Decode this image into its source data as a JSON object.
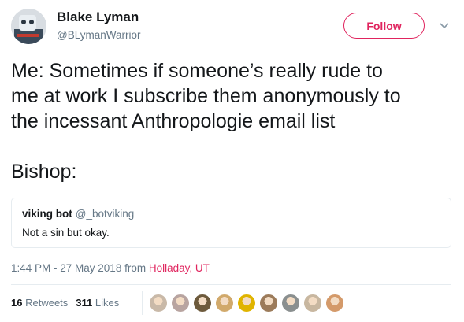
{
  "author": {
    "display_name": "Blake Lyman",
    "handle": "@BLymanWarrior"
  },
  "follow_button": {
    "label": "Follow",
    "accent": "#e0245e"
  },
  "menu_caret_icon": "chevron-down-icon",
  "tweet": {
    "lines": [
      "Me: Sometimes if someone’s really rude to",
      "me at work I subscribe them anonymously to",
      "the incessant Anthropologie email list",
      "Bishop:"
    ]
  },
  "quote": {
    "name": "viking bot",
    "handle": "@_botviking",
    "text": "Not a sin but okay."
  },
  "meta": {
    "time_date": "1:44 PM - 27 May 2018",
    "from_label": "from",
    "location": "Holladay, UT"
  },
  "stats": {
    "retweets_count": "16",
    "retweets_label": "Retweets",
    "likes_count": "311",
    "likes_label": "Likes"
  },
  "likers": [
    {
      "color": "#c9b9a8"
    },
    {
      "color": "#b8a4a0"
    },
    {
      "color": "#6d5a3c"
    },
    {
      "color": "#d1a96b"
    },
    {
      "color": "#e0b400"
    },
    {
      "color": "#9c7b5a"
    },
    {
      "color": "#8a8f8f"
    },
    {
      "color": "#c8b7a0"
    },
    {
      "color": "#d49a6a"
    }
  ],
  "colors": {
    "text": "#14171a",
    "secondary": "#657786",
    "border": "#e6ecf0",
    "accent": "#e0245e"
  }
}
